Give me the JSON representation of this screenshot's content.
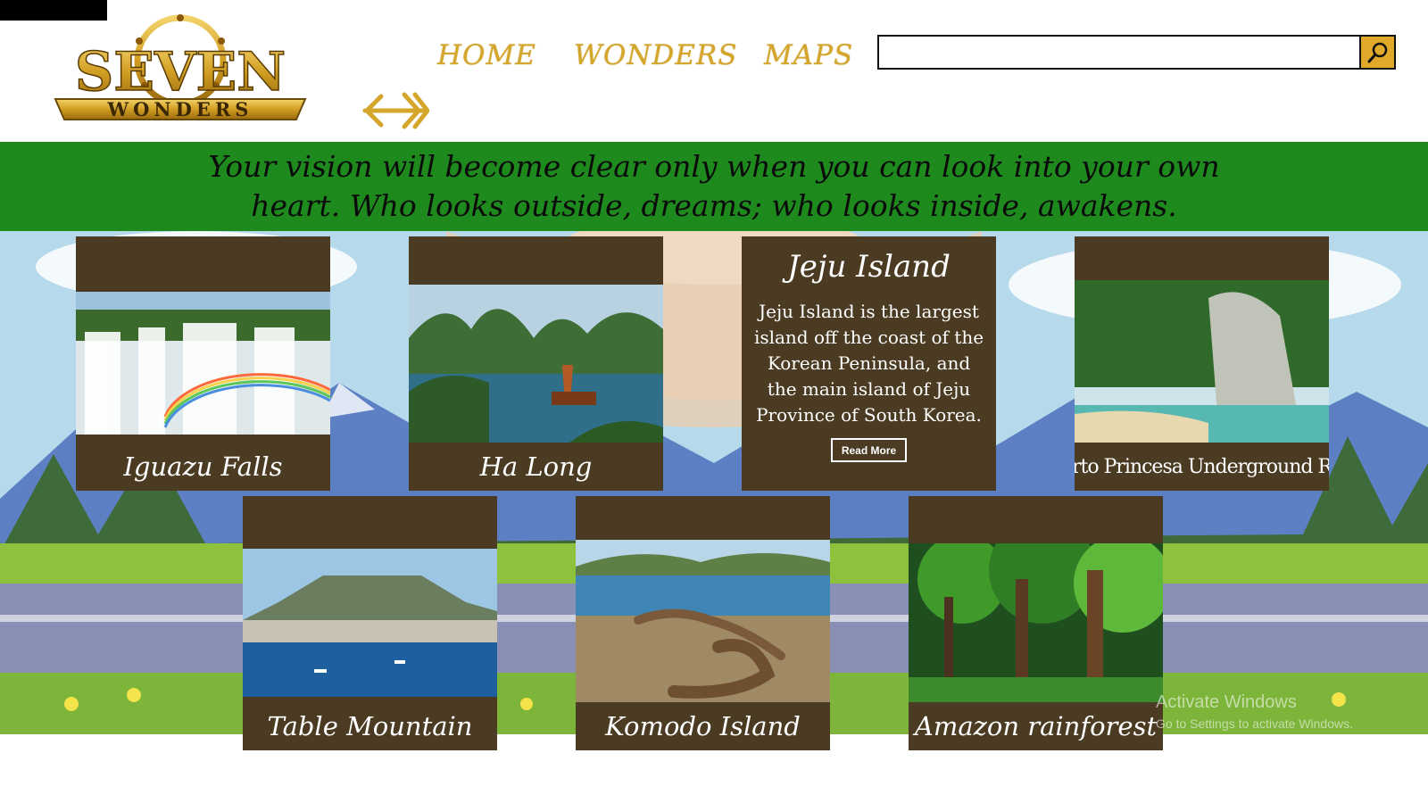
{
  "header": {
    "logo_text_top": "SEVEN",
    "logo_text_bottom": "WONDERS",
    "nav": [
      {
        "label": "HOME"
      },
      {
        "label": "WONDERS"
      },
      {
        "label": "MAPS"
      }
    ],
    "search": {
      "placeholder": "",
      "value": ""
    },
    "back_icon": "double-arrow-left-icon",
    "search_icon": "search-icon"
  },
  "quote": "Your vision will become clear only when you can look into your own heart. Who looks outside, dreams; who looks inside, awakens.",
  "colors": {
    "accent_gold": "#d4a72c",
    "banner_green": "#1e8a1e",
    "card_brown": "#4a3b22"
  },
  "cards": [
    {
      "title": "Iguazu Falls"
    },
    {
      "title": "Ha Long"
    },
    {
      "title": "Jeju Island",
      "description": "Jeju Island is the largest island off the coast of the Korean Peninsula, and the main island of Jeju Province of South Korea.",
      "button": "Read More"
    },
    {
      "title": "Puerto Princesa Underground River"
    },
    {
      "title": "Table Mountain"
    },
    {
      "title": "Komodo Island"
    },
    {
      "title": "Amazon rainforest"
    }
  ],
  "watermark": {
    "line1": "Activate Windows",
    "line2": "Go to Settings to activate Windows."
  }
}
